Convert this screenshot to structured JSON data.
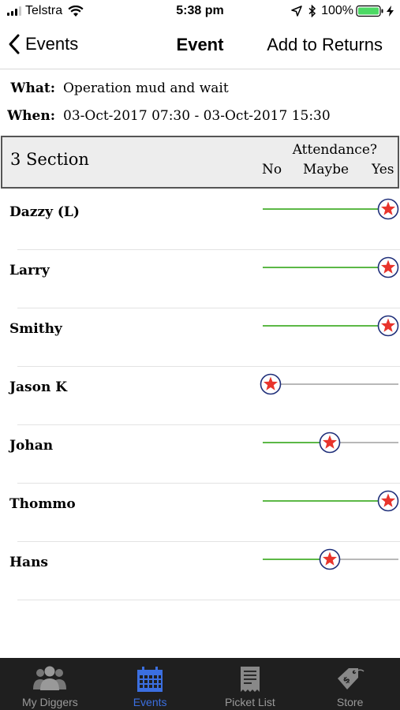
{
  "status_bar": {
    "carrier": "Telstra",
    "time": "5:38 pm",
    "battery": "100%"
  },
  "nav": {
    "back_label": "Events",
    "title": "Event",
    "action_label": "Add to Returns"
  },
  "event": {
    "what_label": "What:",
    "what_value": "Operation mud and wait",
    "when_label": "When:",
    "when_value": "03-Oct-2017 07:30 - 03-Oct-2017 15:30"
  },
  "section": {
    "title": "3 Section",
    "attendance_label": "Attendance?",
    "options": [
      "No",
      "Maybe",
      "Yes"
    ]
  },
  "members": [
    {
      "name": "Dazzy (L)",
      "attendance": "Yes"
    },
    {
      "name": "Larry",
      "attendance": "Yes"
    },
    {
      "name": "Smithy",
      "attendance": "Yes"
    },
    {
      "name": "Jason K",
      "attendance": "No"
    },
    {
      "name": "Johan",
      "attendance": "Maybe"
    },
    {
      "name": "Thommo",
      "attendance": "Yes"
    },
    {
      "name": "Hans",
      "attendance": "Maybe"
    }
  ],
  "tabs": [
    {
      "label": "My Diggers",
      "icon": "people-icon",
      "active": false
    },
    {
      "label": "Events",
      "icon": "calendar-icon",
      "active": true
    },
    {
      "label": "Picket List",
      "icon": "receipt-icon",
      "active": false
    },
    {
      "label": "Store",
      "icon": "price-tag-icon",
      "active": false
    }
  ],
  "colors": {
    "slider_active": "#5cb846",
    "slider_inactive": "#b8b8b8",
    "star": "#e8342c",
    "star_ring": "#1f2f7a",
    "tab_active": "#3b6fe0"
  }
}
